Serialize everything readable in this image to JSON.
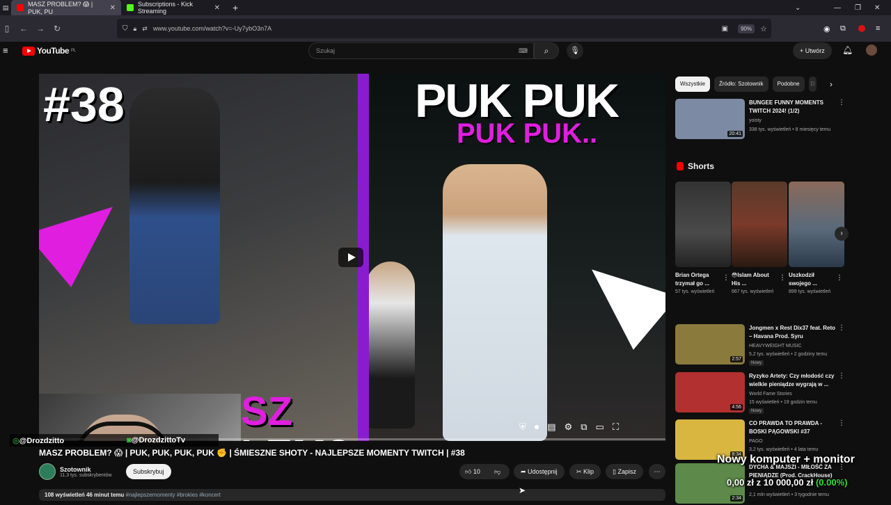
{
  "browser": {
    "tabs": [
      {
        "label": "MASZ PROBLEM? 😱 | PUK, PU",
        "active": true,
        "favicon_color": "#ff0000"
      },
      {
        "label": "Subscriptions - Kick Streaming",
        "active": false,
        "favicon_color": "#53fc18"
      }
    ],
    "url": "www.youtube.com/watch?v=-Uy7ybO3n7A",
    "zoom": "90%"
  },
  "yt": {
    "logo_text": "YouTube",
    "logo_region": "PL",
    "search_placeholder": "Szukaj",
    "create_label": "Utwórz"
  },
  "video": {
    "thumb_number": "#38",
    "thumb_puk1": "PUK PUK",
    "thumb_puk2": "PUK PUK..",
    "cam_text_line1": "SZ",
    "cam_text_line2": "LEM?",
    "social_ig": "@Drozdzitto",
    "social_tv": "@DrozdzittoTv",
    "title": "MASZ PROBLEM? 😱 | PUK, PUK, PUK, PUK ✊ | ŚMIESZNE SHOTY - NAJLEPSZE MOMENTY TWITCH | #38",
    "channel_name": "Szotownik",
    "channel_subs": "11,3 tys. subskrybentów",
    "subscribe_label": "Subskrybuj",
    "likes": "10",
    "share_label": "Udostępnij",
    "clip_label": "Klip",
    "save_label": "Zapisz",
    "views_time": "108 wyświetleń  46 minut temu",
    "hashtags": "#najlepszemomenty #brokies #koncert"
  },
  "sidebar": {
    "chips": [
      "Wszystkie",
      "Źródło: Szotownik",
      "Podobne",
      "D"
    ],
    "recs": [
      {
        "title": "BUNGEE FUNNY MOMENTS TWITCH 2024! (1/2)",
        "channel": "yoisty",
        "meta": "338 tys. wyświetleń • 8 miesięcy temu",
        "duration": "20:41",
        "thumb_color": "#7c8aa4"
      },
      {
        "title": "Jongmen x Rest Dix37 feat. Reto – Havana Prod. Syru",
        "channel": "HEAVYWEIGHT MUSIC",
        "meta": "5,2 tys. wyświetleń • 2 godziny temu",
        "badge": "Nowy",
        "duration": "2:57",
        "thumb_color": "#8a7a3c"
      },
      {
        "title": "Ryzyko Artety: Czy młodość czy wielkie pieniądze wygrają w ...",
        "channel": "World Fame Stories",
        "meta": "15 wyświetleń • 19 godzin temu",
        "badge": "Nowy",
        "duration": "4:56",
        "thumb_color": "#b23030"
      },
      {
        "title": "CO PRAWDA TO PRAWDA - BOSKI PĄGOWSKI #37",
        "channel": "PAGO",
        "meta": "3,2 tys. wyświetleń • 4 lata temu",
        "duration": "8:34",
        "thumb_color": "#d8b640"
      },
      {
        "title": "DYCHA & MAJSZI - MIŁOŚĆ ZA PIENIĄDZE (Prod. CrackHouse)",
        "channel": "",
        "meta": "2,1 mln wyświetleń • 3 tygodnie temu",
        "duration": "2:34",
        "thumb_color": "#5d8a4a"
      }
    ],
    "shorts_title": "Shorts",
    "shorts": [
      {
        "title": "Brian Ortega trzymał go ...",
        "views": "57 tys. wyświetleń",
        "thumb_color": "#4a4a4a"
      },
      {
        "title": "😳Islam About His ...",
        "views": "667 tys. wyświetleń",
        "thumb_color": "#7a3a2a"
      },
      {
        "title": "Uszkodził swojego ...",
        "views": "899 tys. wyświetleń",
        "thumb_color": "#5a6a7a"
      }
    ]
  },
  "overlay": {
    "line1": "Nowy komputer + monitor",
    "line2_prefix": "0,00 zł z 10 000,00 zł",
    "line2_pct": "(0.00%)"
  }
}
